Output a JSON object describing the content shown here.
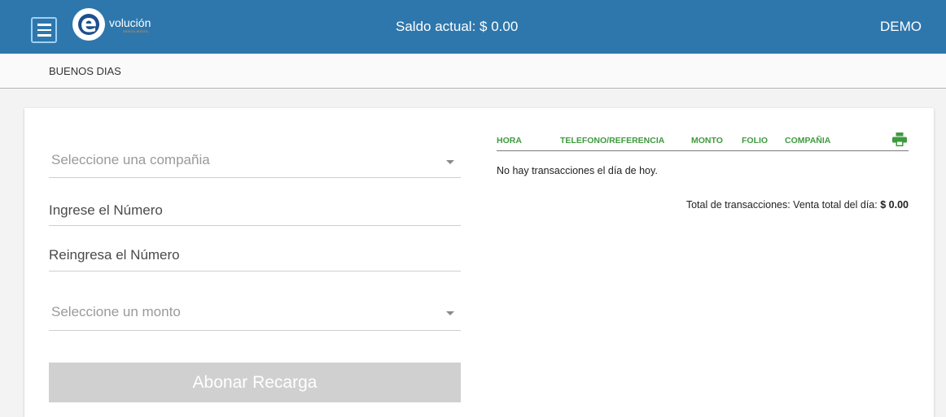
{
  "header": {
    "logo_text": "volución",
    "logo_sub": "VENTA MÓVIL",
    "balance_label": "Saldo actual: $ 0.00",
    "user": "DEMO"
  },
  "greeting": "BUENOS DIAS",
  "form": {
    "company_select": "Seleccione una compañia",
    "number_placeholder": "Ingrese el Número",
    "reenter_placeholder": "Reingresa el Número",
    "amount_select": "Seleccione un monto",
    "submit_label": "Abonar Recarga"
  },
  "transactions": {
    "columns": [
      "HORA",
      "TELEFONO/REFERENCIA",
      "MONTO",
      "FOLIO",
      "COMPAÑIA"
    ],
    "empty_message": "No hay transacciones el día de hoy.",
    "totals_label": "Total de transacciones: Venta total del día:",
    "totals_value": "$ 0.00"
  },
  "icons": {
    "menu": "hamburger-icon",
    "print": "printer-icon"
  },
  "colors": {
    "header_bg": "#2e77ad",
    "accent_green": "#3f9a3f",
    "button_disabled": "#d0d0d0"
  }
}
